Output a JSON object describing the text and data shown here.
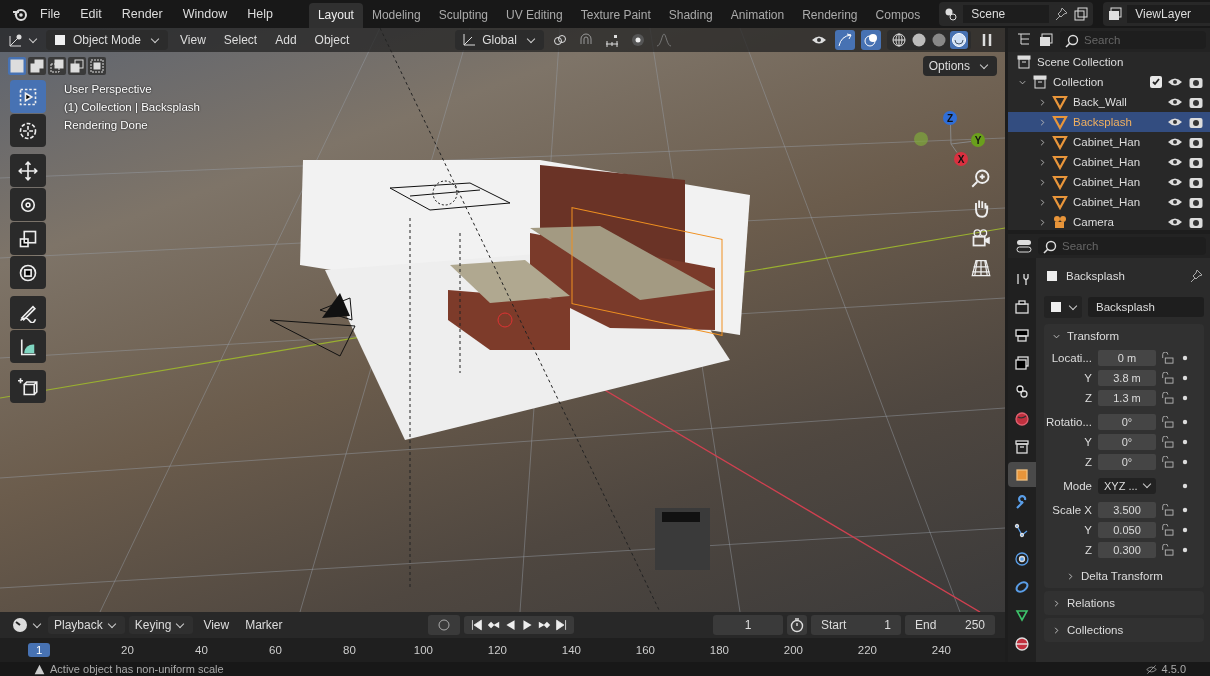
{
  "menu": [
    "File",
    "Edit",
    "Render",
    "Window",
    "Help"
  ],
  "workspace_tabs": [
    {
      "label": "Layout",
      "selected": true
    },
    {
      "label": "Modeling",
      "selected": false
    },
    {
      "label": "Sculpting",
      "selected": false
    },
    {
      "label": "UV Editing",
      "selected": false
    },
    {
      "label": "Texture Paint",
      "selected": false
    },
    {
      "label": "Shading",
      "selected": false
    },
    {
      "label": "Animation",
      "selected": false
    },
    {
      "label": "Rendering",
      "selected": false
    },
    {
      "label": "Compos",
      "selected": false
    }
  ],
  "scene": {
    "name": "Scene"
  },
  "view_layer": {
    "name": "ViewLayer"
  },
  "viewport": {
    "mode": "Object Mode",
    "menus": [
      "View",
      "Select",
      "Add",
      "Object"
    ],
    "orientation": "Global",
    "options": "Options",
    "select_modes": [
      {
        "kind": "new",
        "selected": true
      },
      {
        "kind": "extend",
        "selected": false
      },
      {
        "kind": "subtract",
        "selected": false
      },
      {
        "kind": "invert",
        "selected": false
      },
      {
        "kind": "intersect",
        "selected": false
      }
    ],
    "shading": [
      {
        "kind": "wireframe",
        "selected": false
      },
      {
        "kind": "solid",
        "selected": false
      },
      {
        "kind": "material",
        "selected": false
      },
      {
        "kind": "rendered",
        "selected": true
      }
    ],
    "overlay_lines": [
      "User Perspective",
      "(1) Collection | Backsplash",
      "Rendering Done"
    ],
    "tools": [
      {
        "kind": "select",
        "selected": true
      },
      {
        "kind": "cursor",
        "selected": false
      },
      {
        "kind": "move",
        "selected": false
      },
      {
        "kind": "rotate",
        "selected": false
      },
      {
        "kind": "scale",
        "selected": false
      },
      {
        "kind": "transform",
        "selected": false
      },
      {
        "kind": "annotate",
        "selected": false
      },
      {
        "kind": "measure",
        "selected": false
      },
      {
        "kind": "add-cube",
        "selected": false
      }
    ],
    "gizmo_axes": [
      {
        "label": "Z",
        "color": "#2f6ed8"
      },
      {
        "label": "Y",
        "color": "#6a9f1c"
      },
      {
        "label": "X",
        "color": "#d9303f"
      }
    ]
  },
  "timeline": {
    "menus": [
      "Playback",
      "Keying",
      "View",
      "Marker"
    ],
    "frame_field": "1",
    "start_label": "Start",
    "start": "1",
    "end_label": "End",
    "end": "250",
    "playhead": "1",
    "ruler": [
      "20",
      "40",
      "60",
      "80",
      "100",
      "120",
      "140",
      "160",
      "180",
      "200",
      "220",
      "240"
    ]
  },
  "status": {
    "message": "Active object has non-uniform scale",
    "version": "4.5.0"
  },
  "outliner": {
    "search": {
      "placeholder": "Search"
    },
    "root": "Scene Collection",
    "items": [
      {
        "label": "Collection",
        "kind": "collection",
        "expanded": true,
        "checked": true,
        "selected": false,
        "children": [
          {
            "label": "Back_Wall",
            "kind": "mesh",
            "expanded": false,
            "selected": false
          },
          {
            "label": "Backsplash",
            "kind": "mesh",
            "expanded": false,
            "selected": true
          },
          {
            "label": "Cabinet_Han",
            "kind": "mesh",
            "expanded": false,
            "selected": false
          },
          {
            "label": "Cabinet_Han",
            "kind": "mesh",
            "expanded": false,
            "selected": false
          },
          {
            "label": "Cabinet_Han",
            "kind": "mesh",
            "expanded": false,
            "selected": false
          },
          {
            "label": "Cabinet_Han",
            "kind": "mesh",
            "expanded": false,
            "selected": false
          },
          {
            "label": "Camera",
            "kind": "camera",
            "expanded": false,
            "selected": false
          }
        ]
      }
    ]
  },
  "properties": {
    "search": {
      "placeholder": "Search"
    },
    "tabs": [
      {
        "kind": "tool",
        "selected": false
      },
      {
        "kind": "render",
        "selected": false
      },
      {
        "kind": "output",
        "selected": false
      },
      {
        "kind": "view-layer",
        "selected": false
      },
      {
        "kind": "scene",
        "selected": false
      },
      {
        "kind": "world",
        "selected": false
      },
      {
        "kind": "collection",
        "selected": false
      },
      {
        "kind": "object",
        "selected": true
      },
      {
        "kind": "modifier",
        "selected": false
      },
      {
        "kind": "particles",
        "selected": false
      },
      {
        "kind": "physics",
        "selected": false
      },
      {
        "kind": "constraints",
        "selected": false
      },
      {
        "kind": "data",
        "selected": false
      },
      {
        "kind": "material",
        "selected": false
      }
    ],
    "object_name": "Backsplash",
    "data_name": "Backsplash",
    "transform": {
      "title": "Transform",
      "expanded": true,
      "groups": [
        {
          "kind": "fields",
          "rows": [
            {
              "label": "Locati...",
              "value": "0 m"
            },
            {
              "label": "Y",
              "value": "3.8 m"
            },
            {
              "label": "Z",
              "value": "1.3 m"
            }
          ]
        },
        {
          "kind": "fields",
          "rows": [
            {
              "label": "Rotatio...",
              "value": "0°"
            },
            {
              "label": "Y",
              "value": "0°"
            },
            {
              "label": "Z",
              "value": "0°"
            }
          ]
        },
        {
          "kind": "dropdown",
          "rows": [
            {
              "label": "Mode",
              "value": "XYZ ..."
            }
          ]
        },
        {
          "kind": "fields",
          "rows": [
            {
              "label": "Scale X",
              "value": "3.500"
            },
            {
              "label": "Y",
              "value": "0.050"
            },
            {
              "label": "Z",
              "value": "0.300"
            }
          ]
        }
      ],
      "subpanel": {
        "title": "Delta Transform",
        "expanded": false
      }
    },
    "panels": [
      {
        "title": "Relations",
        "expanded": false
      },
      {
        "title": "Collections",
        "expanded": false
      }
    ]
  }
}
